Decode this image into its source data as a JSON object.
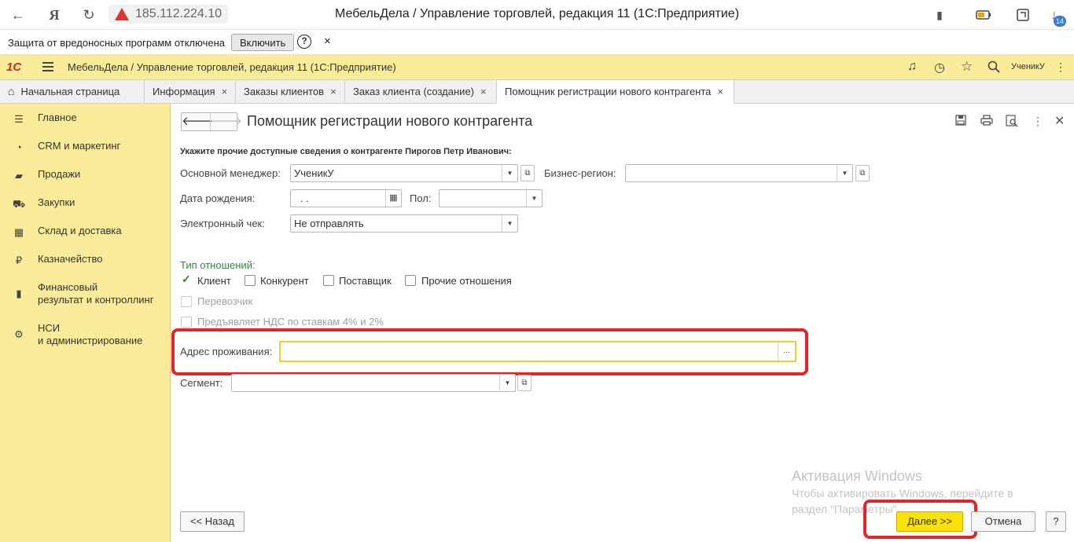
{
  "browser": {
    "url": "185.112.224.10",
    "title": "МебельДела / Управление торговлей, редакция 11  (1С:Предприятие)",
    "ext_badge": "14"
  },
  "notice": {
    "text": "Защита от вредоносных программ отключена",
    "enable_label": "Включить",
    "help": "?",
    "close": "×"
  },
  "app": {
    "logo": "1С",
    "title": "МебельДела / Управление торговлей, редакция 11  (1С:Предприятие)",
    "user": "УченикУ"
  },
  "tabs": [
    {
      "label": "Начальная страница"
    },
    {
      "label": "Информация"
    },
    {
      "label": "Заказы клиентов"
    },
    {
      "label": "Заказ клиента (создание)"
    },
    {
      "label": "Помощник регистрации нового контрагента"
    }
  ],
  "sidebar": {
    "items": [
      {
        "label": "Главное"
      },
      {
        "label": "CRM и маркетинг"
      },
      {
        "label": "Продажи"
      },
      {
        "label": "Закупки"
      },
      {
        "label": "Склад и доставка"
      },
      {
        "label": "Казначейство"
      },
      {
        "label": "Финансовый"
      },
      {
        "label": "результат и контроллинг"
      },
      {
        "label": "НСИ"
      },
      {
        "label": "и администрирование"
      }
    ]
  },
  "form": {
    "title": "Помощник регистрации нового контрагента",
    "header": "Укажите прочие доступные сведения о контрагенте Пирогов Петр Иванович:",
    "manager_label": "Основной менеджер:",
    "manager_value": "УченикУ",
    "region_label": "Бизнес-регион:",
    "region_value": "",
    "birth_label": "Дата рождения:",
    "birth_value": " .  .",
    "gender_label": "Пол:",
    "gender_value": "",
    "check_label": "Электронный чек:",
    "check_value": "Не отправлять",
    "relation_label": "Тип отношений:",
    "relations": [
      {
        "label": "Клиент"
      },
      {
        "label": "Конкурент"
      },
      {
        "label": "Поставщик"
      },
      {
        "label": "Прочие отношения"
      },
      {
        "label": "Перевозчик"
      },
      {
        "label": "Предъявляет НДС по ставкам 4% и 2%"
      }
    ],
    "address_label": "Адрес проживания:",
    "address_value": "",
    "segment_label": "Сегмент:",
    "segment_value": ""
  },
  "buttons": {
    "back": "<< Назад",
    "next": "Далее >>",
    "cancel": "Отмена",
    "help": "?"
  },
  "watermark": {
    "title": "Активация Windows",
    "line1": "Чтобы активировать Windows, перейдите в",
    "line2": "раздел \"Параметры\"."
  }
}
